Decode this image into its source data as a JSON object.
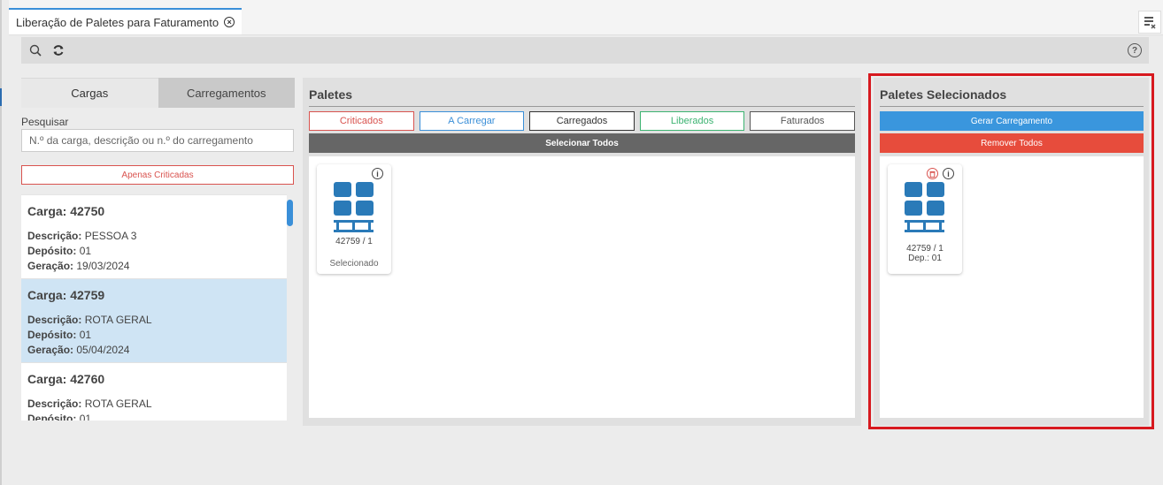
{
  "tab": {
    "title": "Liberação de Paletes para Faturamento"
  },
  "toolbar": {
    "search_icon": "search-icon",
    "refresh_icon": "refresh-icon",
    "help": "?"
  },
  "left": {
    "tabs": [
      {
        "label": "Cargas"
      },
      {
        "label": "Carregamentos"
      }
    ],
    "search_label": "Pesquisar",
    "search_placeholder": "N.º da carga, descrição ou n.º do carregamento",
    "filter_button": "Apenas Criticadas",
    "field_labels": {
      "descricao": "Descrição:",
      "deposito": "Depósito:",
      "geracao": "Geração:"
    },
    "cargas": [
      {
        "title": "Carga: 42750",
        "descricao": "PESSOA 3",
        "deposito": "01",
        "geracao": "19/03/2024",
        "selected": false
      },
      {
        "title": "Carga: 42759",
        "descricao": "ROTA GERAL",
        "deposito": "01",
        "geracao": "05/04/2024",
        "selected": true
      },
      {
        "title": "Carga: 42760",
        "descricao": "ROTA GERAL",
        "deposito": "01",
        "geracao": "",
        "selected": false
      }
    ]
  },
  "center": {
    "title": "Paletes",
    "filters": [
      {
        "label": "Criticados",
        "color": "#d9534f"
      },
      {
        "label": "A Carregar",
        "color": "#3a8fd8"
      },
      {
        "label": "Carregados",
        "color": "#333333"
      },
      {
        "label": "Liberados",
        "color": "#3cb371"
      },
      {
        "label": "Faturados",
        "color": "#555555"
      }
    ],
    "select_all": "Selecionar Todos",
    "pallet": {
      "code": "42759 / 1",
      "status": "Selecionado",
      "info": "i"
    }
  },
  "right": {
    "title": "Paletes Selecionados",
    "generate_button": "Gerar Carregamento",
    "remove_button": "Remover Todos",
    "pallet": {
      "code": "42759 / 1",
      "deposit": "Dep.: 01",
      "info": "i"
    }
  },
  "colors": {
    "pallet_blue": "#2a7ab8",
    "highlight_red": "#d7191f"
  }
}
